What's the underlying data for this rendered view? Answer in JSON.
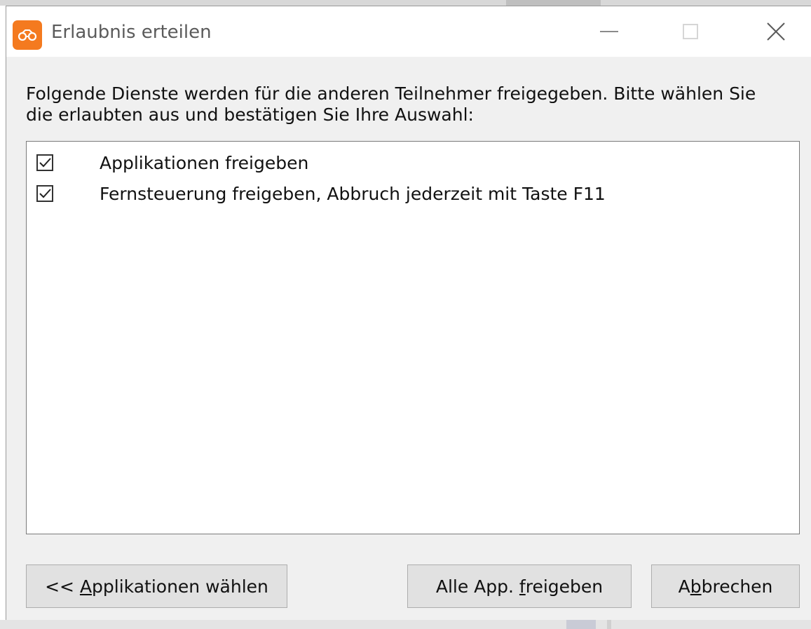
{
  "window": {
    "title": "Erlaubnis erteilen",
    "app_icon": "orange-app-logo-icon",
    "controls": {
      "minimize_icon": "minimize-icon",
      "maximize_icon": "maximize-icon",
      "close_icon": "close-icon",
      "close_glyph": "✕"
    }
  },
  "prompt": {
    "line1": "Folgende Dienste werden für die anderen Teilnehmer freigegeben. Bitte wählen Sie",
    "line2": "die erlaubten aus und bestätigen Sie Ihre Auswahl:"
  },
  "services": [
    {
      "label": "Applikationen freigeben",
      "checked": true
    },
    {
      "label": "Fernsteuerung freigeben, Abbruch jederzeit mit Taste F11",
      "checked": true
    }
  ],
  "buttons": {
    "choose_apps": {
      "prefix": "<< ",
      "accel": "A",
      "rest": "pplikationen wählen"
    },
    "share_all": {
      "before": "Alle App. ",
      "accel": "f",
      "rest": "reigeben"
    },
    "cancel": {
      "before": "A",
      "accel": "b",
      "rest": "brechen"
    }
  },
  "colors": {
    "accent": "#f47a1f",
    "dialog_bg": "#f0f0f0",
    "button_bg": "#e1e1e1"
  }
}
